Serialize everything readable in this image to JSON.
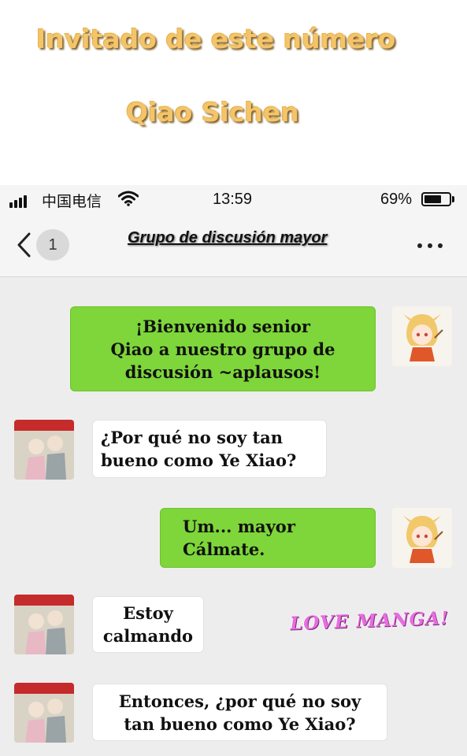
{
  "caption": {
    "line1": "Invitado de este número",
    "line2": "Qiao Sichen"
  },
  "status_bar": {
    "carrier": "中国电信",
    "time": "13:59",
    "battery": "69%",
    "battery_level": 0.69
  },
  "header": {
    "back_icon": "chevron-left-icon",
    "unread_count": "1",
    "title": "Grupo de discusión  mayor",
    "more_icon": "more-dots-icon"
  },
  "messages": [
    {
      "side": "right",
      "lines": [
        "¡Bienvenido senior",
        "Qiao a nuestro grupo de",
        "discusión ~aplausos!"
      ]
    },
    {
      "side": "left",
      "lines": [
        "¿Por qué no soy tan",
        "bueno como Ye Xiao?"
      ]
    },
    {
      "side": "right",
      "lines": [
        "Um... mayor",
        "Cálmate."
      ]
    },
    {
      "side": "left",
      "lines": [
        "Estoy",
        "calmando"
      ]
    },
    {
      "side": "left",
      "lines": [
        "Entonces, ¿por qué no soy",
        "tan bueno como Ye Xiao?"
      ]
    }
  ],
  "watermark": "LOVE MANGA!",
  "colors": {
    "sent_bubble": "#7ed63a",
    "received_bubble": "#ffffff",
    "chat_background": "#ededed",
    "caption_text": "#f3c46a"
  }
}
